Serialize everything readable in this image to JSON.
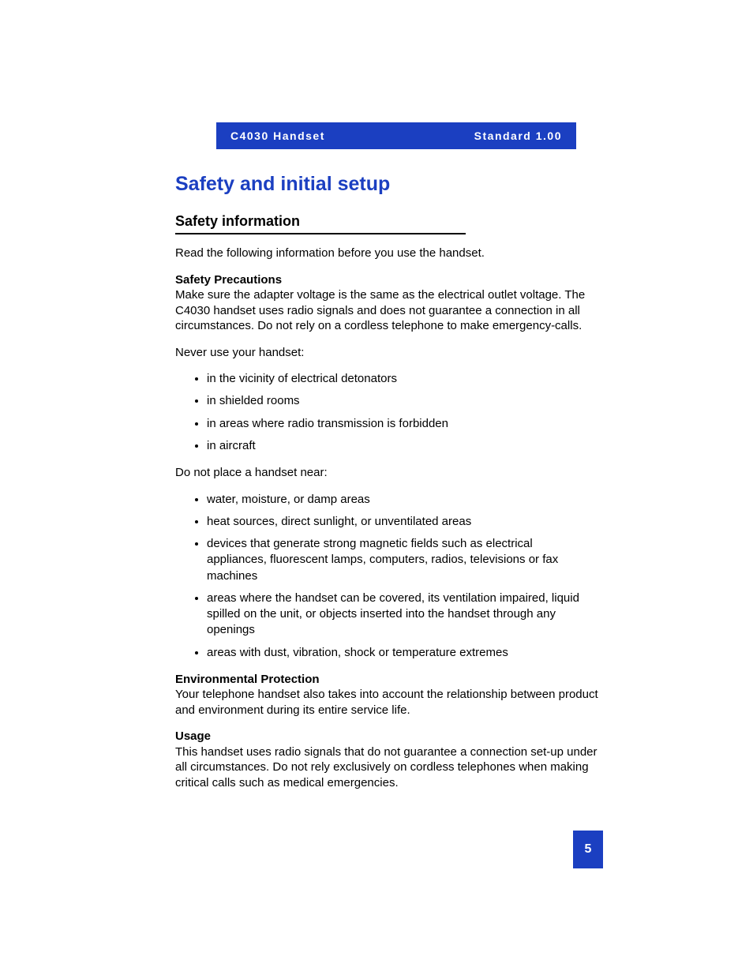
{
  "banner": {
    "left": "C4030 Handset",
    "right": "Standard 1.00"
  },
  "chapter_title": "Safety and initial setup",
  "section_title": "Safety information",
  "intro": "Read the following information before you use the handset.",
  "safety_precautions": {
    "heading": "Safety Precautions",
    "para1": "Make sure the adapter voltage is the same as the electrical outlet voltage. The C4030 handset uses radio signals and does not guarantee a connection in all circumstances. Do not rely on a cordless telephone to make emergency-calls.",
    "never_use_intro": "Never use your handset:",
    "never_use": [
      "in the vicinity of electrical detonators",
      "in shielded rooms",
      "in areas where radio transmission is forbidden",
      "in aircraft"
    ],
    "do_not_place_intro": "Do not place a handset near:",
    "do_not_place": [
      "water, moisture, or damp areas",
      "heat sources, direct sunlight, or unventilated areas",
      "devices that generate strong magnetic fields such as electrical appliances, fluorescent lamps, computers, radios, televisions or fax machines",
      "areas where the handset can be covered, its ventilation impaired, liquid spilled on the unit, or objects inserted into the handset through any openings",
      "areas with dust, vibration, shock or temperature extremes"
    ]
  },
  "env_protection": {
    "heading": "Environmental Protection",
    "text": "Your telephone handset also takes into account the relationship between product and environment during its entire service life."
  },
  "usage": {
    "heading": "Usage",
    "text": "This handset uses radio signals that do not guarantee a connection set-up under all circumstances. Do not rely exclusively on cordless telephones when making critical calls such as medical emergencies."
  },
  "page_number": "5"
}
